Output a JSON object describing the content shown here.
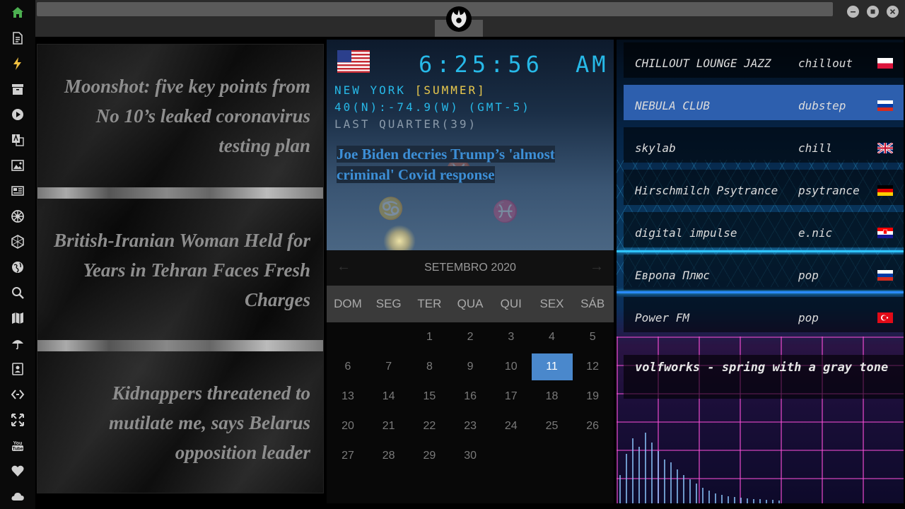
{
  "sidebar": {
    "items": [
      {
        "icon": "home-icon",
        "color": "#4caf50"
      },
      {
        "icon": "document-icon"
      },
      {
        "icon": "lightning-icon",
        "color": "#f0c040"
      },
      {
        "icon": "archive-icon"
      },
      {
        "icon": "play-icon"
      },
      {
        "icon": "translate-icon"
      },
      {
        "icon": "image-icon"
      },
      {
        "icon": "newspaper-icon"
      },
      {
        "icon": "empire-icon"
      },
      {
        "icon": "hexagon-icon"
      },
      {
        "icon": "globe-icon"
      },
      {
        "icon": "search-icon"
      },
      {
        "icon": "map-icon"
      },
      {
        "icon": "umbrella-icon"
      },
      {
        "icon": "contacts-icon"
      },
      {
        "icon": "code-icon"
      },
      {
        "icon": "expand-icon"
      },
      {
        "icon": "youtube-icon"
      },
      {
        "icon": "heart-icon"
      },
      {
        "icon": "cloud-icon"
      }
    ]
  },
  "news": {
    "items": [
      {
        "title": "Moonshot: five key points from No 10’s leaked coronavirus testing plan"
      },
      {
        "title": "British-Iranian Woman Held for Years in Tehran Faces Fresh Charges"
      },
      {
        "title": "Kidnappers threatened to mutilate me, says Belarus opposition leader"
      }
    ]
  },
  "clock": {
    "time": "6:25:56",
    "ampm": "AM",
    "city": "NEW YORK ",
    "season": "[SUMMER]",
    "coords": "40(N):-74.9(W) (GMT-5)",
    "moon": "LAST QUARTER(39)",
    "headline": "Joe Biden decries Trump’s 'almost criminal' Covid response"
  },
  "calendar": {
    "title": "SETEMBRO 2020",
    "prev": "←",
    "next": "→",
    "weekdays": [
      "DOM",
      "SEG",
      "TER",
      "QUA",
      "QUI",
      "SEX",
      "SÁB"
    ],
    "first_weekday": 2,
    "days_in_month": 30,
    "today": 11
  },
  "radio": {
    "stations": [
      {
        "name": "CHILLOUT LOUNGE JAZZ",
        "genre": "chillout",
        "country": "pl"
      },
      {
        "name": "NEBULA CLUB",
        "genre": "dubstep",
        "country": "ru",
        "active": true
      },
      {
        "name": "skylab",
        "genre": "chill",
        "country": "gb"
      },
      {
        "name": "Hirschmilch Psytrance",
        "genre": "psytrance",
        "country": "de"
      },
      {
        "name": "digital impulse",
        "genre": "e.nic",
        "country": "hr"
      },
      {
        "name": "Европа Плюс",
        "genre": "pop",
        "country": "ru"
      },
      {
        "name": "Power FM",
        "genre": "pop",
        "country": "tr"
      }
    ],
    "now_playing": "volfworks - spring with a gray tone"
  },
  "colors": {
    "accent": "#4a88cc",
    "lcd": "#27b9e8",
    "season": "#e8c84d",
    "headline": "#3d8fd6"
  }
}
